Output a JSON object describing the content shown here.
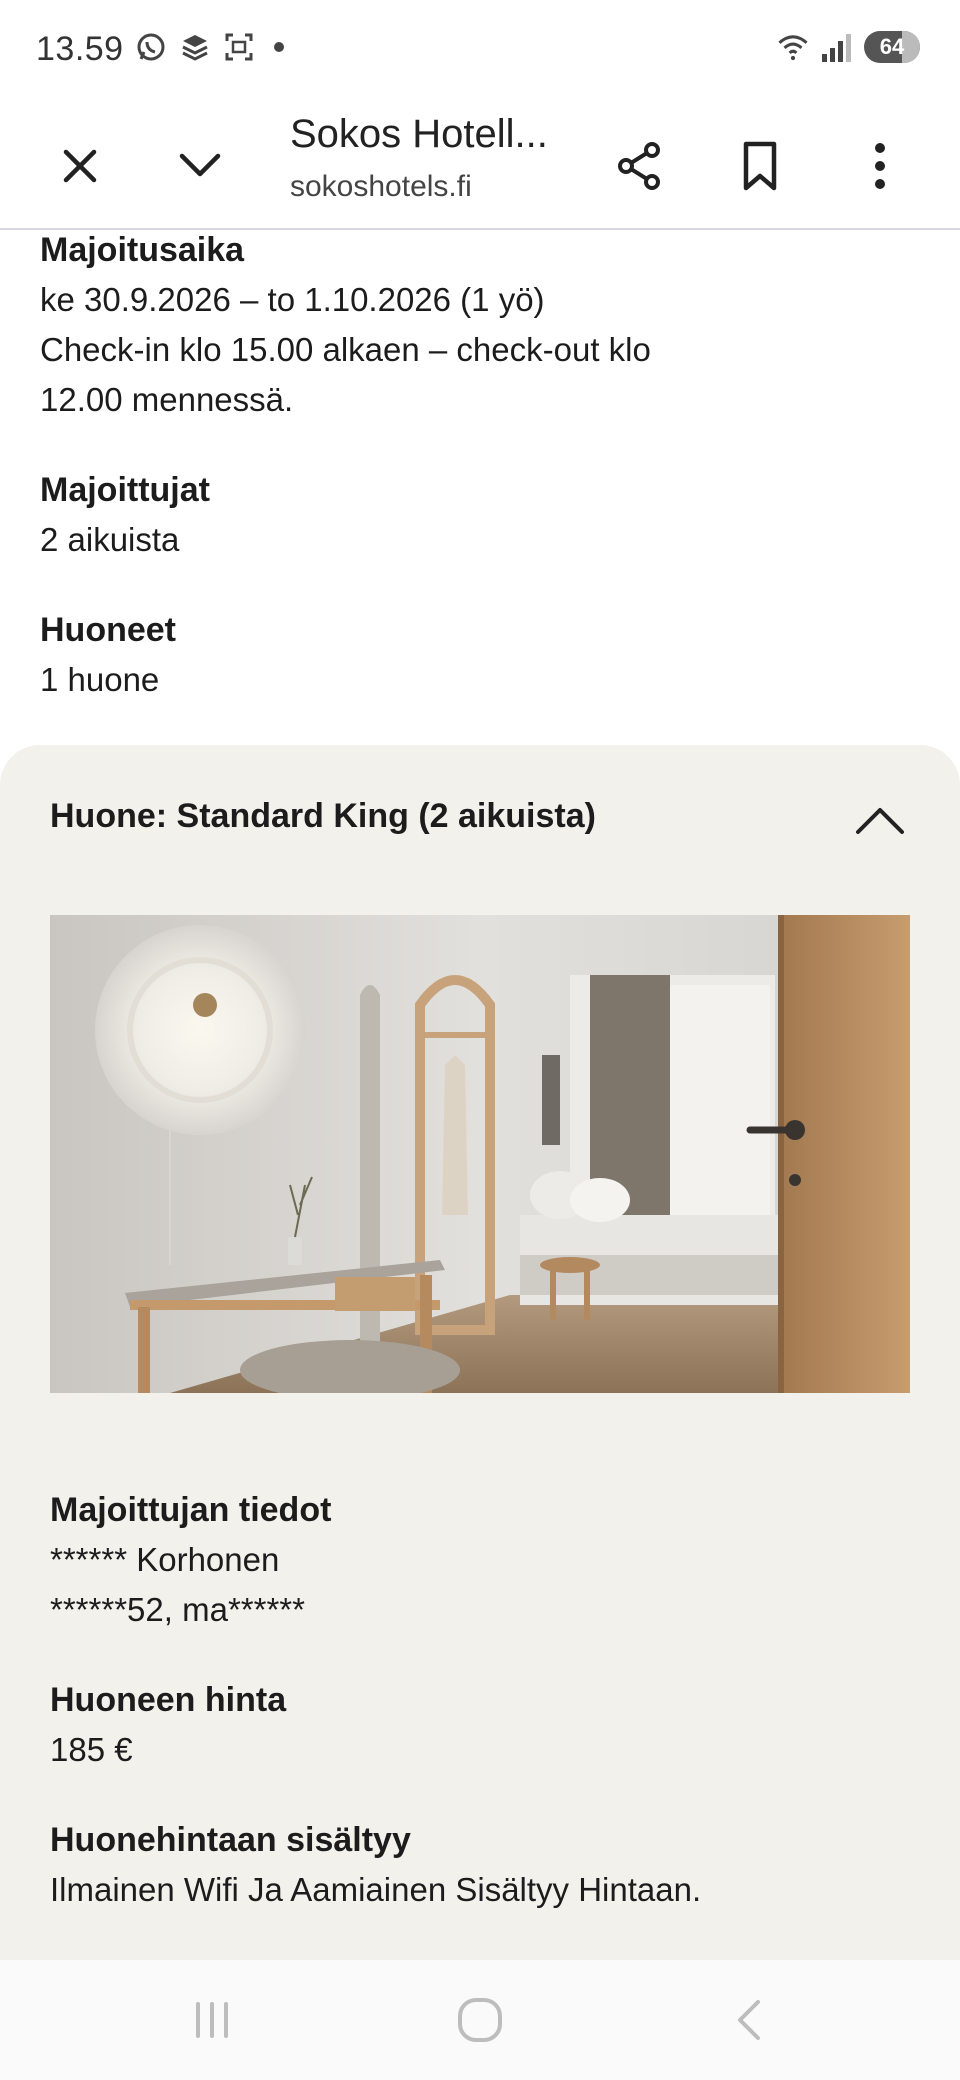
{
  "status_bar": {
    "time": "13.59",
    "battery": "64"
  },
  "toolbar": {
    "title": "Sokos Hotell...",
    "url": "sokoshotels.fi"
  },
  "stay": {
    "label": "Majoitusaika",
    "dates": "ke 30.9.2026 – to 1.10.2026 (1 yö)",
    "checkin_line1": "Check-in klo 15.00 alkaen – check-out klo",
    "checkin_line2": "12.00 mennessä."
  },
  "guests": {
    "label": "Majoittujat",
    "value": "2 aikuista"
  },
  "rooms": {
    "label": "Huoneet",
    "value": "1 huone"
  },
  "room_card": {
    "heading": "Huone: Standard King (2 aikuista)",
    "guest_info": {
      "label": "Majoittujan tiedot",
      "name": "****** Korhonen",
      "address": "******52, ma******"
    },
    "price": {
      "label": "Huoneen hinta",
      "value": "185 €"
    },
    "includes": {
      "label": "Huonehintaan sisältyy",
      "value": "Ilmainen Wifi Ja Aamiainen Sisältyy Hintaan."
    }
  }
}
